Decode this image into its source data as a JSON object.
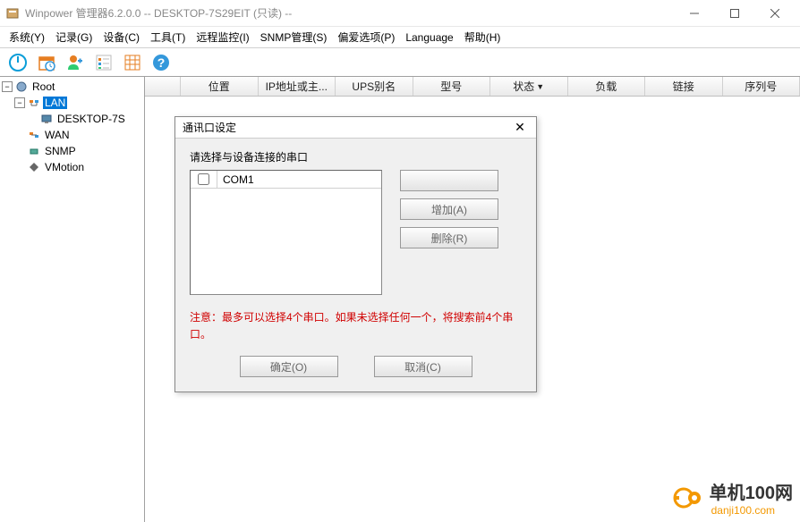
{
  "titlebar": {
    "text": "Winpower 管理器6.2.0.0 -- DESKTOP-7S29EIT (只读) --"
  },
  "menu": {
    "system": "系统(Y)",
    "log": "记录(G)",
    "device": "设备(C)",
    "tools": "工具(T)",
    "remote": "远程监控(I)",
    "snmp": "SNMP管理(S)",
    "preferences": "偏爱选项(P)",
    "language": "Language",
    "help": "帮助(H)"
  },
  "tree": {
    "root": "Root",
    "lan": "LAN",
    "desktop": "DESKTOP-7S",
    "wan": "WAN",
    "snmp": "SNMP",
    "vmotion": "VMotion"
  },
  "table": {
    "col_location": "位置",
    "col_ip": "IP地址或主...",
    "col_alias": "UPS别名",
    "col_model": "型号",
    "col_status": "状态",
    "col_load": "负载",
    "col_link": "链接",
    "col_serial": "序列号"
  },
  "dialog": {
    "title": "通讯口设定",
    "label": "请选择与设备连接的串口",
    "ports": [
      {
        "name": "COM1",
        "checked": false
      }
    ],
    "btn_blank": "",
    "btn_add": "增加(A)",
    "btn_remove": "删除(R)",
    "notice": "注意：最多可以选择4个串口。如果未选择任何一个，将搜索前4个串口。",
    "btn_ok": "确定(O)",
    "btn_cancel": "取消(C)"
  },
  "watermark": {
    "text1": "单机100网",
    "text2": "danji100.com"
  }
}
